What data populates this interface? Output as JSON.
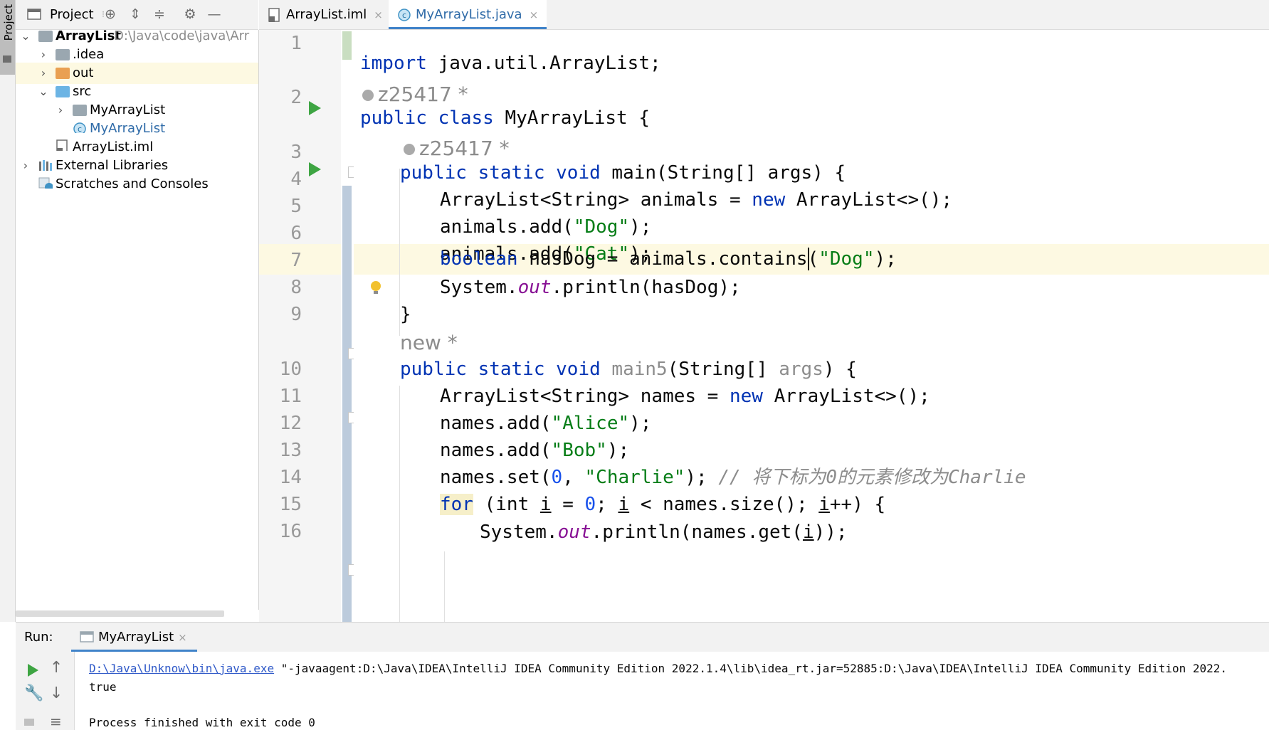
{
  "sidebar_stripe": {
    "label": "Project"
  },
  "project_panel": {
    "title": "Project",
    "tree": [
      {
        "label": "ArrayList",
        "path": "D:\\Java\\code\\java\\Arr"
      },
      {
        "label": ".idea"
      },
      {
        "label": "out"
      },
      {
        "label": "src"
      },
      {
        "label": "MyArrayList"
      },
      {
        "label": "MyArrayList"
      },
      {
        "label": "ArrayList.iml"
      },
      {
        "label": "External Libraries"
      },
      {
        "label": "Scratches and Consoles"
      }
    ]
  },
  "editor_tabs": [
    {
      "label": "ArrayList.iml",
      "close": "×"
    },
    {
      "label": "MyArrayList.java",
      "close": "×"
    }
  ],
  "editor": {
    "line_numbers": [
      "1",
      "2",
      "3",
      "4",
      "5",
      "6",
      "7",
      "8",
      "9",
      "10",
      "11",
      "12",
      "13",
      "14",
      "15",
      "16"
    ],
    "author_hint_1": "z25417 *",
    "author_hint_2": "z25417 *",
    "author_hint_3": "new *",
    "code": {
      "l1_kw": "import",
      "l1_rest": " java.util.ArrayList;",
      "l2_kw": "public class",
      "l2_rest": " MyArrayList {",
      "l3_kw": "public static void",
      "l3_rest": " main(String[] args) {",
      "l4_a": "ArrayList<String> animals = ",
      "l4_kw": "new",
      "l4_b": " ArrayList<>();",
      "l5_a": "animals.add(",
      "l5_str": "\"Dog\"",
      "l5_b": ");",
      "l6_a": "animals.add(",
      "l6_str": "\"Cat\"",
      "l6_b": ");",
      "l7_kw": "boolean",
      "l7_a": " hasDog = animals.contains(",
      "l7_str": "\"Dog\"",
      "l7_b": ");",
      "l8_a": "System.",
      "l8_it": "out",
      "l8_b": ".println(hasDog);",
      "l9": "}",
      "l10_kw": "public static void",
      "l10_gray": " main5",
      "l10_a": "(String[] ",
      "l10_gray2": "args",
      "l10_b": ") {",
      "l11_a": "ArrayList<String> names = ",
      "l11_kw": "new",
      "l11_b": " ArrayList<>();",
      "l12_a": "names.add(",
      "l12_str": "\"Alice\"",
      "l12_b": ");",
      "l13_a": "names.add(",
      "l13_str": "\"Bob\"",
      "l13_b": ");",
      "l14_a": "names.set(",
      "l14_num": "0",
      "l14_c": ", ",
      "l14_str": "\"Charlie\"",
      "l14_b": "); ",
      "l14_cmt": "// 将下标为0的元素修改为Charlie",
      "l15_kw": "for",
      "l15_a": " (int ",
      "l15_i1": "i",
      "l15_b": " = ",
      "l15_num": "0",
      "l15_c": "; ",
      "l15_i2": "i",
      "l15_d": " < names.size(); ",
      "l15_i3": "i",
      "l15_e": "++) {",
      "l16_a": "System.",
      "l16_it": "out",
      "l16_b": ".println(names.get(",
      "l16_i": "i",
      "l16_c": "));"
    }
  },
  "run_panel": {
    "label": "Run:",
    "tab": "MyArrayList",
    "tab_close": "×",
    "console": {
      "cmd_link": "D:\\Java\\Unknow\\bin\\java.exe",
      "cmd_rest": " \"-javaagent:D:\\Java\\IDEA\\IntelliJ IDEA Community Edition 2022.1.4\\lib\\idea_rt.jar=52885:D:\\Java\\IDEA\\IntelliJ IDEA Community Edition 2022.",
      "output": "true",
      "exit": "Process finished with exit code 0"
    }
  },
  "colors": {
    "keyword": "#0033b3",
    "string": "#067d17",
    "number": "#1750eb",
    "static_field": "#871094",
    "current_line": "#fdf9e2",
    "run_green": "#3ea543"
  }
}
